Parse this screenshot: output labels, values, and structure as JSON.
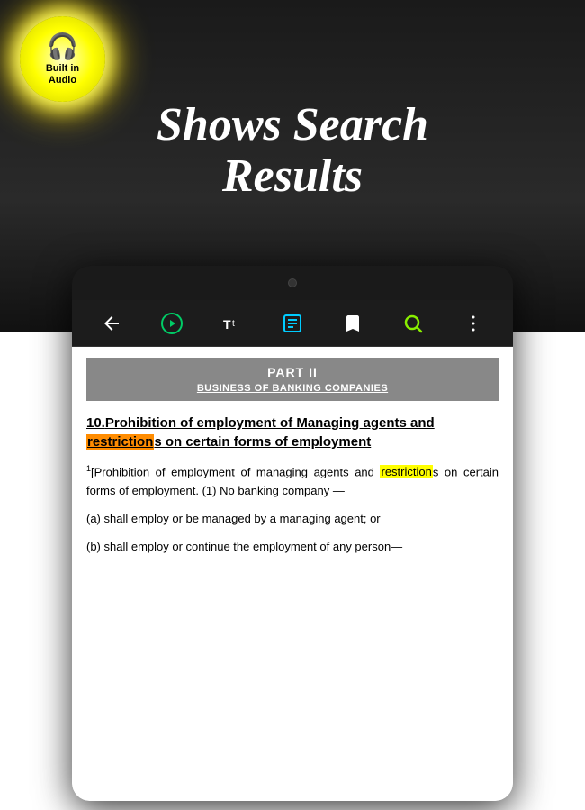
{
  "background": {
    "top_color": "#1a1a1a",
    "bottom_color": "#ffffff"
  },
  "audio_badge": {
    "icon": "🎧",
    "line1": "Built in",
    "line2": "Audio"
  },
  "header": {
    "title_line1": "Shows Search",
    "title_line2": "Results"
  },
  "tablet": {
    "toolbar": {
      "back_label": "←",
      "play_label": "▶",
      "text_label": "Tt",
      "note_label": "≡",
      "bookmark_label": "★",
      "search_label": "🔍",
      "more_label": "⋮"
    },
    "document": {
      "part_label": "PART II",
      "business_label": "BUSINESS OF BANKING COMPANIES",
      "section_number": "10.",
      "section_title_plain": "Prohibition of employment of Managing agents and ",
      "section_title_highlight": "restriction",
      "section_title_end": "s on certain forms of employment",
      "body_superscript": "1",
      "body_text_1": "[Prohibition of employment of managing agents and ",
      "body_highlight": "restriction",
      "body_text_2": "s on certain forms of employment. (1) No banking company —",
      "item_a": "(a) shall employ or be managed by a managing agent; or",
      "item_b": "(b) shall employ or continue the employment of any person—"
    }
  }
}
